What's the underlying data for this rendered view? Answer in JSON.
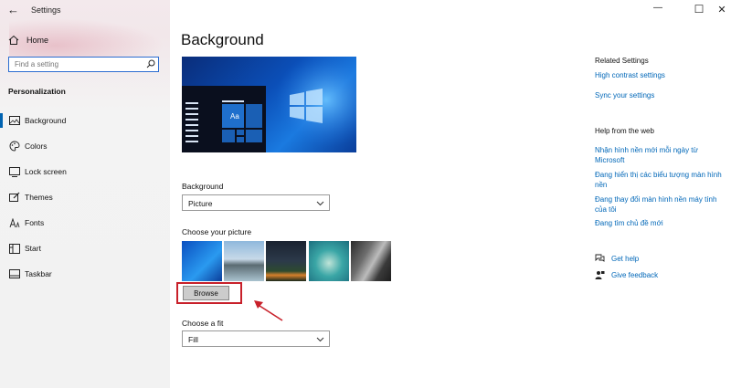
{
  "window": {
    "title": "Settings",
    "back_glyph": "←",
    "minimize_glyph": "—",
    "maximize_glyph": "☐",
    "close_glyph": "✕"
  },
  "sidebar": {
    "home_label": "Home",
    "search_placeholder": "Find a setting",
    "section_heading": "Personalization",
    "items": [
      {
        "label": "Background",
        "icon": "picture-icon",
        "active": true
      },
      {
        "label": "Colors",
        "icon": "palette-icon",
        "active": false
      },
      {
        "label": "Lock screen",
        "icon": "lock-screen-icon",
        "active": false
      },
      {
        "label": "Themes",
        "icon": "brush-icon",
        "active": false
      },
      {
        "label": "Fonts",
        "icon": "fonts-icon",
        "active": false
      },
      {
        "label": "Start",
        "icon": "start-icon",
        "active": false
      },
      {
        "label": "Taskbar",
        "icon": "taskbar-icon",
        "active": false
      }
    ]
  },
  "main": {
    "title": "Background",
    "preview_tile_text": "Aa",
    "background_label": "Background",
    "background_value": "Picture",
    "choose_picture_label": "Choose your picture",
    "browse_label": "Browse",
    "choose_fit_label": "Choose a fit",
    "fit_value": "Fill",
    "annotation_color": "#c8202a"
  },
  "related": {
    "heading": "Related Settings",
    "links": [
      "High contrast settings",
      "Sync your settings"
    ]
  },
  "help_web": {
    "heading": "Help from the web",
    "links": [
      "Nhận hình nền mới mỗi ngày từ Microsoft",
      "Đang hiển thị các biểu tượng màn hình nền",
      "Đang thay đổi màn hình nền máy tính của tôi",
      "Đang tìm chủ đề mới"
    ]
  },
  "support": {
    "get_help": "Get help",
    "give_feedback": "Give feedback"
  },
  "colors": {
    "accent": "#0063b1",
    "link": "#0067b8"
  }
}
